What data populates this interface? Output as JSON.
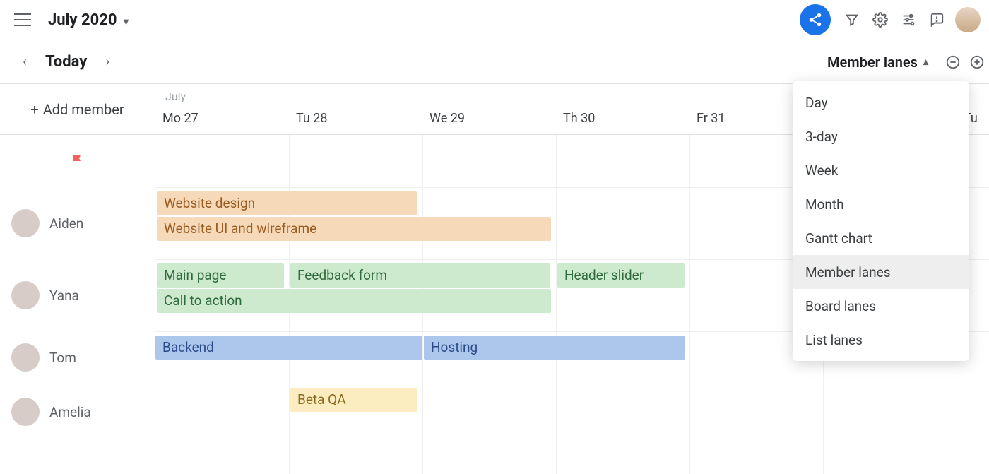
{
  "header": {
    "title": "July 2020"
  },
  "subheader": {
    "today": "Today",
    "view": "Member lanes"
  },
  "sidebar": {
    "add_member": "Add member",
    "members": [
      {
        "name": "Aiden"
      },
      {
        "name": "Yana"
      },
      {
        "name": "Tom"
      },
      {
        "name": "Amelia"
      }
    ]
  },
  "timeline": {
    "month_label": "July",
    "days": [
      "Mo 27",
      "Tu 28",
      "We 29",
      "Th 30",
      "Fr 31",
      "",
      "Tu "
    ]
  },
  "tasks": {
    "aiden": [
      {
        "label": "Website design"
      },
      {
        "label": "Website UI and wireframe"
      }
    ],
    "yana": [
      {
        "label": "Main page"
      },
      {
        "label": "Feedback form"
      },
      {
        "label": "Header slider"
      },
      {
        "label": "Call to action"
      }
    ],
    "tom": [
      {
        "label": "Backend"
      },
      {
        "label": "Hosting"
      }
    ],
    "amelia": [
      {
        "label": "Beta QA"
      }
    ]
  },
  "dropdown": {
    "items": [
      {
        "label": "Day"
      },
      {
        "label": "3-day"
      },
      {
        "label": "Week"
      },
      {
        "label": "Month"
      },
      {
        "label": "Gantt chart"
      },
      {
        "label": "Member lanes",
        "selected": true
      },
      {
        "label": "Board lanes"
      },
      {
        "label": "List lanes"
      }
    ]
  }
}
